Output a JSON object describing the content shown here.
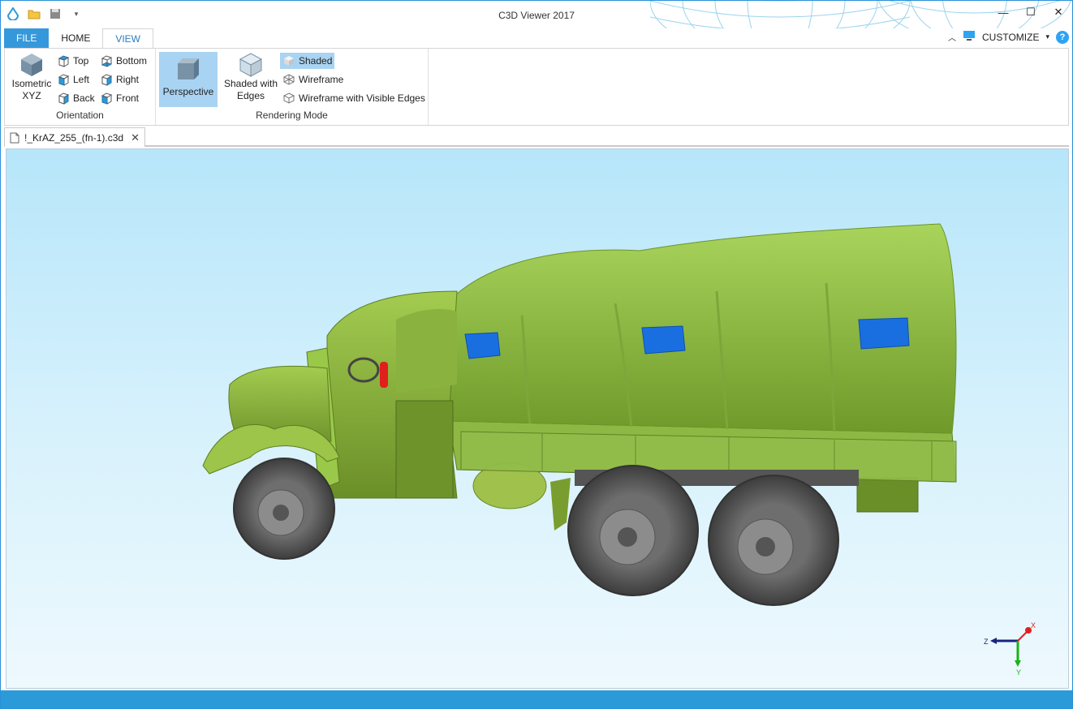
{
  "app": {
    "title": "C3D Viewer 2017",
    "accent_color": "#3598db",
    "quick_access": [
      "app-logo-icon",
      "open-folder-icon",
      "save-icon",
      "qat-dropdown-icon"
    ],
    "window_controls": {
      "minimize": "—",
      "maximize": "☐",
      "close": "✕"
    }
  },
  "ribbon": {
    "tabs": [
      {
        "label": "FILE"
      },
      {
        "label": "HOME"
      },
      {
        "label": "VIEW"
      }
    ],
    "active_tab": "VIEW",
    "customize_label": "CUSTOMIZE",
    "help_label": "?",
    "orientation": {
      "label": "Orientation",
      "isometric_line1": "Isometric",
      "isometric_line2": "XYZ",
      "top": "Top",
      "left": "Left",
      "back": "Back",
      "bottom": "Bottom",
      "right": "Right",
      "front": "Front"
    },
    "rendering": {
      "label": "Rendering Mode",
      "perspective": "Perspective",
      "shaded_edges_line1": "Shaded with",
      "shaded_edges_line2": "Edges",
      "shaded": "Shaded",
      "wireframe": "Wireframe",
      "wireframe_visible": "Wireframe with Visible Edges"
    }
  },
  "document": {
    "tab_label": "!_KrAZ_255_(fn-1).c3d",
    "close_glyph": "✕"
  },
  "viewport": {
    "model_colors": {
      "body": "#9cc54a",
      "window": "#1a73e8",
      "tire": "#5a5a5a",
      "extinguisher": "#e0201b"
    },
    "axes": {
      "x": "X",
      "y": "Y",
      "z": "Z"
    }
  }
}
